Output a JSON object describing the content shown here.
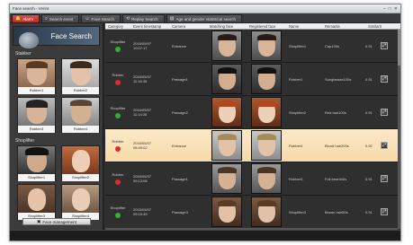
{
  "window": {
    "title": "Face search - Verint"
  },
  "tabs": [
    {
      "label": "Alarm",
      "icon": "bell-icon"
    },
    {
      "label": "Search event",
      "icon": "search-icon"
    },
    {
      "label": "Face Search",
      "icon": "face-icon"
    },
    {
      "label": "Replay Search",
      "icon": "replay-icon"
    },
    {
      "label": "Age and gender statistical search",
      "icon": "chart-icon"
    }
  ],
  "left_panel": {
    "header_title": "Face Search",
    "watchlist_label": "Stabber",
    "watchlist": [
      {
        "name": "Robber1"
      },
      {
        "name": "Robber2"
      },
      {
        "name": "Robber3"
      },
      {
        "name": "Robber4"
      }
    ],
    "shoplifter_label": "Shoplifter",
    "shoplifters": [
      {
        "name": "Shoplifter1"
      },
      {
        "name": "Shoplifter2"
      },
      {
        "name": "Shoplifter3"
      },
      {
        "name": "Shoplifter4"
      }
    ],
    "manage_button": "Face management"
  },
  "table": {
    "columns": [
      "Category",
      "Event timestamp",
      "Camera",
      "Matching face",
      "Registered face",
      "Name",
      "Remarks",
      "Similarit"
    ],
    "rows": [
      {
        "category": "Shoplifter",
        "status_color": "#2fb12f",
        "timestamp": "2016/05/07\n10:07:17",
        "camera": "Entrance",
        "name": "Shoplifter1",
        "remarks": "Cap100s",
        "similarity": "0.91"
      },
      {
        "category": "Robber",
        "status_color": "#e02b2b",
        "timestamp": "2016/05/07\n11:16:35",
        "camera": "Passage1",
        "name": "Robber1",
        "remarks": "Sunglasses100s",
        "similarity": "0.91"
      },
      {
        "category": "Shoplifter",
        "status_color": "#2fb12f",
        "timestamp": "2016/05/07\n11:14:28",
        "camera": "Passage2",
        "name": "Shoplifter2",
        "remarks": "Red hair100s",
        "similarity": "0.91"
      },
      {
        "category": "Robber",
        "status_color": "#e02b2b",
        "timestamp": "2016/05/07\n08:49:02",
        "camera": "Entrance",
        "name": "Robber4",
        "remarks": "Blond hair200s",
        "similarity": "0.92",
        "highlight": true
      },
      {
        "category": "Robber",
        "status_color": "#e02b2b",
        "timestamp": "2016/05/07\n09:13:08",
        "camera": "Passage1",
        "name": "Robber3",
        "remarks": "Full beard40s",
        "similarity": "0.91"
      },
      {
        "category": "Shoplifter",
        "status_color": "#2fb12f",
        "timestamp": "2016/05/07\n09:15:45",
        "camera": "Passage3",
        "name": "Shoplifter3",
        "remarks": "Brown hair50s",
        "similarity": "0.91"
      }
    ]
  }
}
